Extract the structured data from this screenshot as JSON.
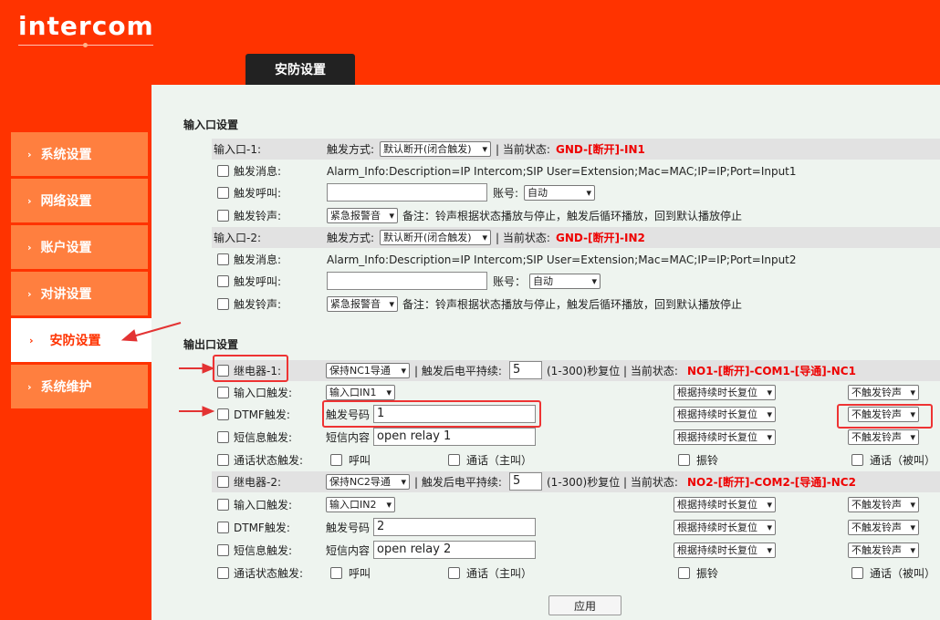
{
  "brand": "intercom",
  "tab_label": "安防设置",
  "sidebar": {
    "items": [
      {
        "label": "系统设置"
      },
      {
        "label": "网络设置"
      },
      {
        "label": "账户设置"
      },
      {
        "label": "对讲设置"
      },
      {
        "label": "安防设置",
        "active": true
      },
      {
        "label": "系统维护"
      }
    ]
  },
  "input_section": {
    "title": "输入口设置",
    "ports": [
      {
        "name": "输入口-1:",
        "trigger_mode_label": "触发方式:",
        "trigger_mode_value": "默认断开(闭合触发)",
        "status_label": "| 当前状态:",
        "status_value": "GND-[断开]-IN1",
        "msg_label": "触发消息:",
        "msg_value": "Alarm_Info:Description=IP Intercom;SIP User=Extension;Mac=MAC;IP=IP;Port=Input1",
        "call_label": "触发呼叫:",
        "account_label": "账号:",
        "account_value": "自动",
        "ring_label": "触发铃声:",
        "ring_value": "紧急报警音",
        "ring_note": "备注：铃声根据状态播放与停止，触发后循环播放，回到默认播放停止"
      },
      {
        "name": "输入口-2:",
        "trigger_mode_label": "触发方式:",
        "trigger_mode_value": "默认断开(闭合触发)",
        "status_label": "| 当前状态:",
        "status_value": "GND-[断开]-IN2",
        "msg_label": "触发消息:",
        "msg_value": "Alarm_Info:Description=IP Intercom;SIP User=Extension;Mac=MAC;IP=IP;Port=Input2",
        "call_label": "触发呼叫:",
        "account_label": "账号：",
        "account_value": "自动",
        "ring_label": "触发铃声:",
        "ring_value": "紧急报警音",
        "ring_note": "备注：铃声根据状态播放与停止，触发后循环播放，回到默认播放停止"
      }
    ]
  },
  "output_section": {
    "title": "输出口设置",
    "relays": [
      {
        "name": "继电器-1:",
        "mode_value": "保持NC1导通",
        "duration_label": "| 触发后电平持续:",
        "duration_value": "5",
        "duration_hint": "(1-300)秒复位 | 当前状态:",
        "status_value": "NO1-[断开]-COM1-[导通]-NC1",
        "input_trigger_label": "输入口触发:",
        "input_trigger_value": "输入口IN1",
        "dtmf_label": "DTMF触发:",
        "dtmf_code_label": "触发号码",
        "dtmf_code_value": "1",
        "sms_label": "短信息触发:",
        "sms_content_label": "短信内容",
        "sms_content_value": "open relay 1",
        "call_state_label": "通话状态触发:",
        "call_opt_1": "呼叫",
        "call_opt_2": "通话（主叫）",
        "call_opt_3": "振铃",
        "call_opt_4": "通话（被叫）",
        "reset_value": "根据持续时长复位",
        "sound_value": "不触发铃声"
      },
      {
        "name": "继电器-2:",
        "mode_value": "保持NC2导通",
        "duration_label": "| 触发后电平持续:",
        "duration_value": "5",
        "duration_hint": "(1-300)秒复位 | 当前状态:",
        "status_value": "NO2-[断开]-COM2-[导通]-NC2",
        "input_trigger_label": "输入口触发:",
        "input_trigger_value": "输入口IN2",
        "dtmf_label": "DTMF触发:",
        "dtmf_code_label": "触发号码",
        "dtmf_code_value": "2",
        "sms_label": "短信息触发:",
        "sms_content_label": "短信内容",
        "sms_content_value": "open relay 2",
        "call_state_label": "通话状态触发:",
        "call_opt_1": "呼叫",
        "call_opt_2": "通话（主叫）",
        "call_opt_3": "振铃",
        "call_opt_4": "通话（被叫）",
        "reset_value": "根据持续时长复位",
        "sound_value": "不触发铃声"
      }
    ]
  },
  "apply_label": "应用",
  "colors": {
    "brand": "#ff3300",
    "sidebar_item": "#ff7f3f",
    "highlight": "#e33333"
  }
}
